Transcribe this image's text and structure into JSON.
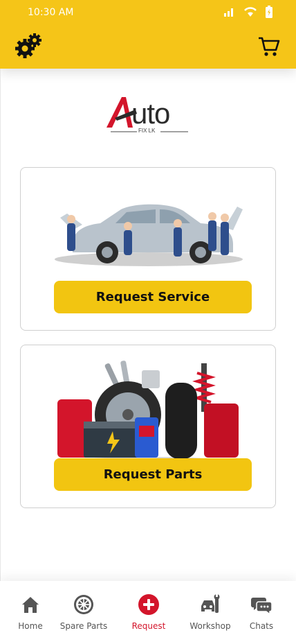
{
  "status_bar": {
    "time": "10:30 AM"
  },
  "header": {
    "settings_icon": "gears-icon",
    "cart_icon": "cart-icon"
  },
  "logo": {
    "word": "uto",
    "sub": "FIX LK"
  },
  "cards": [
    {
      "id": "service",
      "button_label": "Request Service",
      "image": "mechanics-car"
    },
    {
      "id": "parts",
      "button_label": "Request Parts",
      "image": "spare-parts-pile"
    }
  ],
  "bottom_nav": {
    "items": [
      {
        "label": "Home",
        "icon": "home-icon"
      },
      {
        "label": "Spare Parts",
        "icon": "gear-wheel-icon"
      },
      {
        "label": "Request",
        "icon": "plus-circle-icon",
        "active": true
      },
      {
        "label": "Workshop",
        "icon": "wrench-car-icon"
      },
      {
        "label": "Chats",
        "icon": "chat-bubbles-icon"
      }
    ]
  },
  "colors": {
    "accent": "#f5c518",
    "button": "#f2c511",
    "active": "#d3152b",
    "logo_red": "#d3152b"
  }
}
